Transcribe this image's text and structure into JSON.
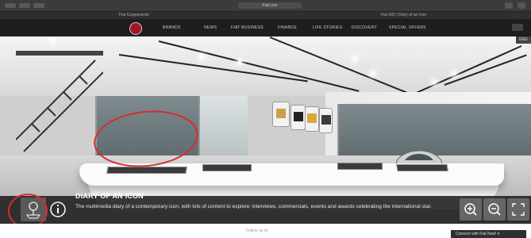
{
  "browser": {
    "tab_title": "Fiat Live",
    "page_host": "Fiat Cinquecento",
    "top_right": "Fiat 500 | Diary of an Icon"
  },
  "nav": {
    "items": [
      "BRANDS",
      "NEWS",
      "FIAT BUSINESS",
      "FINANCE",
      "LIFE STORIES",
      "DISCOVERY",
      "SPECIAL OFFERS"
    ]
  },
  "scene": {
    "corner_label": "ENG"
  },
  "info": {
    "title": "DIARY OF AN ICON",
    "description": "The multimedia diary of a contemporary icon, with lots of content to explore: interviews, commercials, events and awards celebrating the international star."
  },
  "footer": {
    "center_text": "Follow us on",
    "chat_label": "Connect with Fiat Now! ▾"
  },
  "colors": {
    "annotation": "#d92c2c",
    "brand": "#a3162a"
  },
  "icons": [
    "location-icon",
    "info-icon",
    "zoom-in-icon",
    "zoom-out-icon",
    "fullscreen-icon"
  ]
}
